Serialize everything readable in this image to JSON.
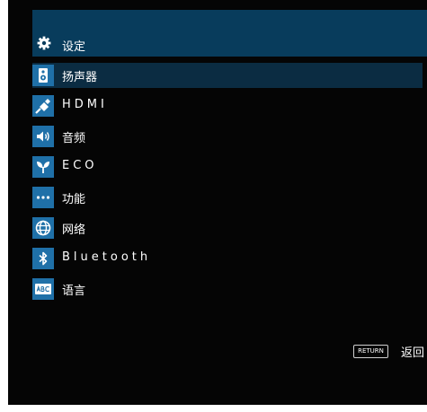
{
  "header": {
    "title": "设定",
    "icon": "gear-icon"
  },
  "menu": [
    {
      "label": "扬声器",
      "icon": "speaker-icon",
      "selected": true
    },
    {
      "label": "HDMI",
      "icon": "hdmi-plug-icon",
      "selected": false
    },
    {
      "label": "音频",
      "icon": "volume-icon",
      "selected": false
    },
    {
      "label": "ECO",
      "icon": "leaf-icon",
      "selected": false
    },
    {
      "label": "功能",
      "icon": "more-dots-icon",
      "selected": false
    },
    {
      "label": "网络",
      "icon": "globe-icon",
      "selected": false
    },
    {
      "label": "Bluetooth",
      "icon": "bluetooth-icon",
      "selected": false
    },
    {
      "label": "语言",
      "icon": "abc-language-icon",
      "selected": false
    }
  ],
  "footer": {
    "return_key": "RETURN",
    "return_label": "返回"
  },
  "colors": {
    "accent": "#1f70a8",
    "header_bg": "#083c5c",
    "selected_bg": "#0b2c42",
    "background": "#050505"
  }
}
